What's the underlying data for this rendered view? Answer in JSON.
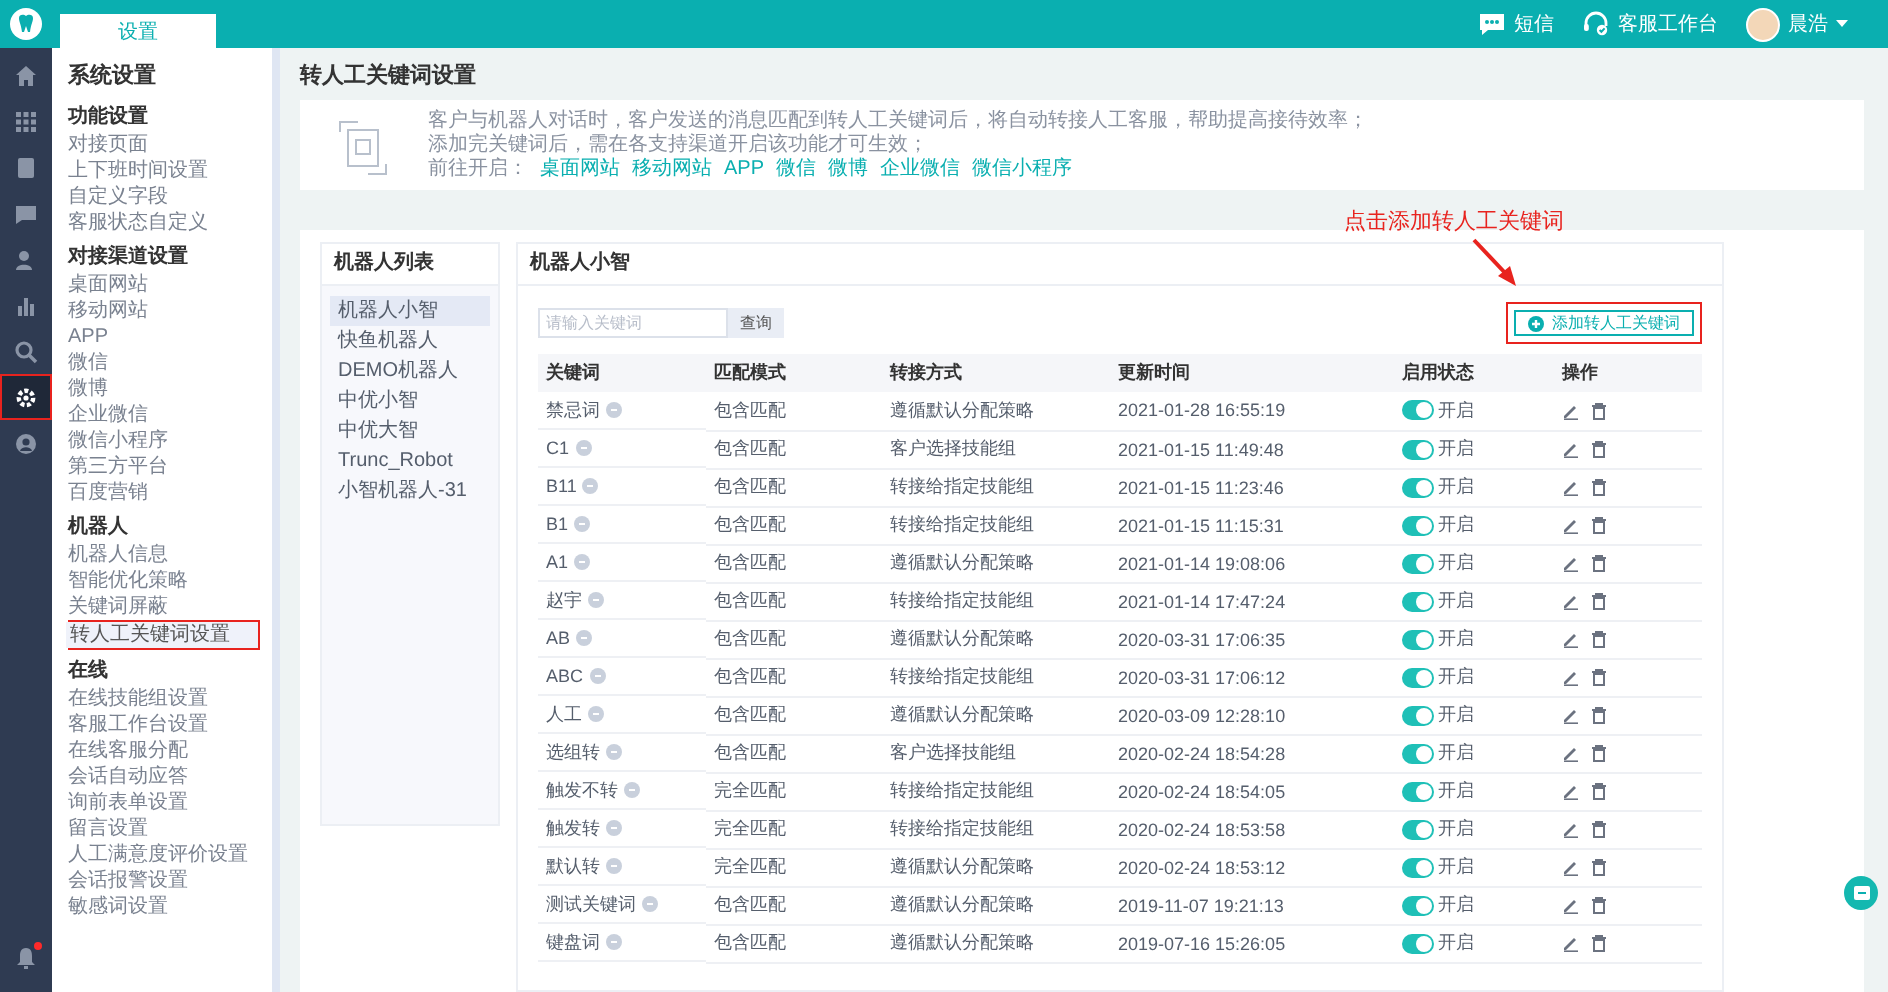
{
  "top_bar": {
    "tab": {
      "label": "设置"
    },
    "actions": [
      {
        "kind": "sms",
        "label": "短信"
      },
      {
        "kind": "workbench",
        "label": "客服工作台"
      }
    ],
    "user": {
      "name": "晨浩"
    }
  },
  "nav_rail": {
    "items": [
      {
        "kind": "home",
        "selected": false,
        "highlighted": false
      },
      {
        "kind": "grid",
        "selected": false,
        "highlighted": false
      },
      {
        "kind": "doc",
        "selected": false,
        "highlighted": false
      },
      {
        "kind": "chat",
        "selected": false,
        "highlighted": false
      },
      {
        "kind": "person",
        "selected": false,
        "highlighted": false
      },
      {
        "kind": "chart",
        "selected": false,
        "highlighted": false
      },
      {
        "kind": "search",
        "selected": false,
        "highlighted": false
      },
      {
        "kind": "gear",
        "selected": true,
        "highlighted": true
      },
      {
        "kind": "user",
        "selected": false,
        "highlighted": false
      }
    ],
    "bell": {
      "unread": true
    }
  },
  "sidebar": {
    "title": "系统设置",
    "groups": [
      {
        "heading": "功能设置",
        "items": [
          {
            "label": "对接页面",
            "selected": false,
            "highlighted": false
          },
          {
            "label": "上下班时间设置",
            "selected": false,
            "highlighted": false
          },
          {
            "label": "自定义字段",
            "selected": false,
            "highlighted": false
          },
          {
            "label": "客服状态自定义",
            "selected": false,
            "highlighted": false
          }
        ]
      },
      {
        "heading": "对接渠道设置",
        "items": [
          {
            "label": "桌面网站",
            "selected": false,
            "highlighted": false
          },
          {
            "label": "移动网站",
            "selected": false,
            "highlighted": false
          },
          {
            "label": "APP",
            "selected": false,
            "highlighted": false
          },
          {
            "label": "微信",
            "selected": false,
            "highlighted": false
          },
          {
            "label": "微博",
            "selected": false,
            "highlighted": false
          },
          {
            "label": "企业微信",
            "selected": false,
            "highlighted": false
          },
          {
            "label": "微信小程序",
            "selected": false,
            "highlighted": false
          },
          {
            "label": "第三方平台",
            "selected": false,
            "highlighted": false
          },
          {
            "label": "百度营销",
            "selected": false,
            "highlighted": false
          }
        ]
      },
      {
        "heading": "机器人",
        "items": [
          {
            "label": "机器人信息",
            "selected": false,
            "highlighted": false
          },
          {
            "label": "智能优化策略",
            "selected": false,
            "highlighted": false
          },
          {
            "label": "关键词屏蔽",
            "selected": false,
            "highlighted": false
          },
          {
            "label": "转人工关键词设置",
            "selected": true,
            "highlighted": true
          }
        ]
      },
      {
        "heading": "在线",
        "items": [
          {
            "label": "在线技能组设置",
            "selected": false,
            "highlighted": false
          },
          {
            "label": "客服工作台设置",
            "selected": false,
            "highlighted": false
          },
          {
            "label": "在线客服分配",
            "selected": false,
            "highlighted": false
          },
          {
            "label": "会话自动应答",
            "selected": false,
            "highlighted": false
          },
          {
            "label": "询前表单设置",
            "selected": false,
            "highlighted": false
          },
          {
            "label": "留言设置",
            "selected": false,
            "highlighted": false
          },
          {
            "label": "人工满意度评价设置",
            "selected": false,
            "highlighted": false
          },
          {
            "label": "会话报警设置",
            "selected": false,
            "highlighted": false
          },
          {
            "label": "敏感词设置",
            "selected": false,
            "highlighted": false
          }
        ]
      }
    ]
  },
  "page_title": "转人工关键词设置",
  "intro": {
    "lines": [
      "客户与机器人对话时，客户发送的消息匹配到转人工关键词后，将自动转接人工客服，帮助提高接待效率；",
      "添加完关键词后，需在各支持渠道开启该功能才可生效；"
    ],
    "links_label": "前往开启：",
    "links": [
      "桌面网站",
      "移动网站",
      "APP",
      "微信",
      "微博",
      "企业微信",
      "微信小程序"
    ]
  },
  "annotation": {
    "text": "点击添加转人工关键词"
  },
  "robot_list": {
    "title": "机器人列表",
    "items": [
      {
        "label": "机器人小智",
        "selected": true
      },
      {
        "label": "快鱼机器人",
        "selected": false
      },
      {
        "label": "DEMO机器人",
        "selected": false
      },
      {
        "label": "中优小智",
        "selected": false
      },
      {
        "label": "中优大智",
        "selected": false
      },
      {
        "label": "Trunc_Robot",
        "selected": false
      },
      {
        "label": "小智机器人-31",
        "selected": false
      }
    ]
  },
  "keyword_panel": {
    "title": "机器人小智",
    "search": {
      "placeholder": "请输入关键词",
      "button": "查询"
    },
    "add_button": {
      "label": "添加转人工关键词",
      "highlighted": true
    },
    "table": {
      "columns": [
        "关键词",
        "匹配模式",
        "转接方式",
        "更新时间",
        "启用状态",
        "操作"
      ],
      "rows": [
        {
          "keyword": "禁忌词",
          "match": "包含匹配",
          "transfer": "遵循默认分配策略",
          "updated": "2021-01-28 16:55:19",
          "enabled": true,
          "status": "开启"
        },
        {
          "keyword": "C1",
          "match": "包含匹配",
          "transfer": "客户选择技能组",
          "updated": "2021-01-15 11:49:48",
          "enabled": true,
          "status": "开启"
        },
        {
          "keyword": "B11",
          "match": "包含匹配",
          "transfer": "转接给指定技能组",
          "updated": "2021-01-15 11:23:46",
          "enabled": true,
          "status": "开启"
        },
        {
          "keyword": "B1",
          "match": "包含匹配",
          "transfer": "转接给指定技能组",
          "updated": "2021-01-15 11:15:31",
          "enabled": true,
          "status": "开启"
        },
        {
          "keyword": "A1",
          "match": "包含匹配",
          "transfer": "遵循默认分配策略",
          "updated": "2021-01-14 19:08:06",
          "enabled": true,
          "status": "开启"
        },
        {
          "keyword": "赵宇",
          "match": "包含匹配",
          "transfer": "转接给指定技能组",
          "updated": "2021-01-14 17:47:24",
          "enabled": true,
          "status": "开启"
        },
        {
          "keyword": "AB",
          "match": "包含匹配",
          "transfer": "遵循默认分配策略",
          "updated": "2020-03-31 17:06:35",
          "enabled": true,
          "status": "开启"
        },
        {
          "keyword": "ABC",
          "match": "包含匹配",
          "transfer": "转接给指定技能组",
          "updated": "2020-03-31 17:06:12",
          "enabled": true,
          "status": "开启"
        },
        {
          "keyword": "人工",
          "match": "包含匹配",
          "transfer": "遵循默认分配策略",
          "updated": "2020-03-09 12:28:10",
          "enabled": true,
          "status": "开启"
        },
        {
          "keyword": "选组转",
          "match": "包含匹配",
          "transfer": "客户选择技能组",
          "updated": "2020-02-24 18:54:28",
          "enabled": true,
          "status": "开启"
        },
        {
          "keyword": "触发不转",
          "match": "完全匹配",
          "transfer": "转接给指定技能组",
          "updated": "2020-02-24 18:54:05",
          "enabled": true,
          "status": "开启"
        },
        {
          "keyword": "触发转",
          "match": "完全匹配",
          "transfer": "转接给指定技能组",
          "updated": "2020-02-24 18:53:58",
          "enabled": true,
          "status": "开启"
        },
        {
          "keyword": "默认转",
          "match": "完全匹配",
          "transfer": "遵循默认分配策略",
          "updated": "2020-02-24 18:53:12",
          "enabled": true,
          "status": "开启"
        },
        {
          "keyword": "测试关键词",
          "match": "包含匹配",
          "transfer": "遵循默认分配策略",
          "updated": "2019-11-07 19:21:13",
          "enabled": true,
          "status": "开启"
        },
        {
          "keyword": "键盘词",
          "match": "包含匹配",
          "transfer": "遵循默认分配策略",
          "updated": "2019-07-16 15:26:05",
          "enabled": true,
          "status": "开启"
        }
      ]
    }
  }
}
